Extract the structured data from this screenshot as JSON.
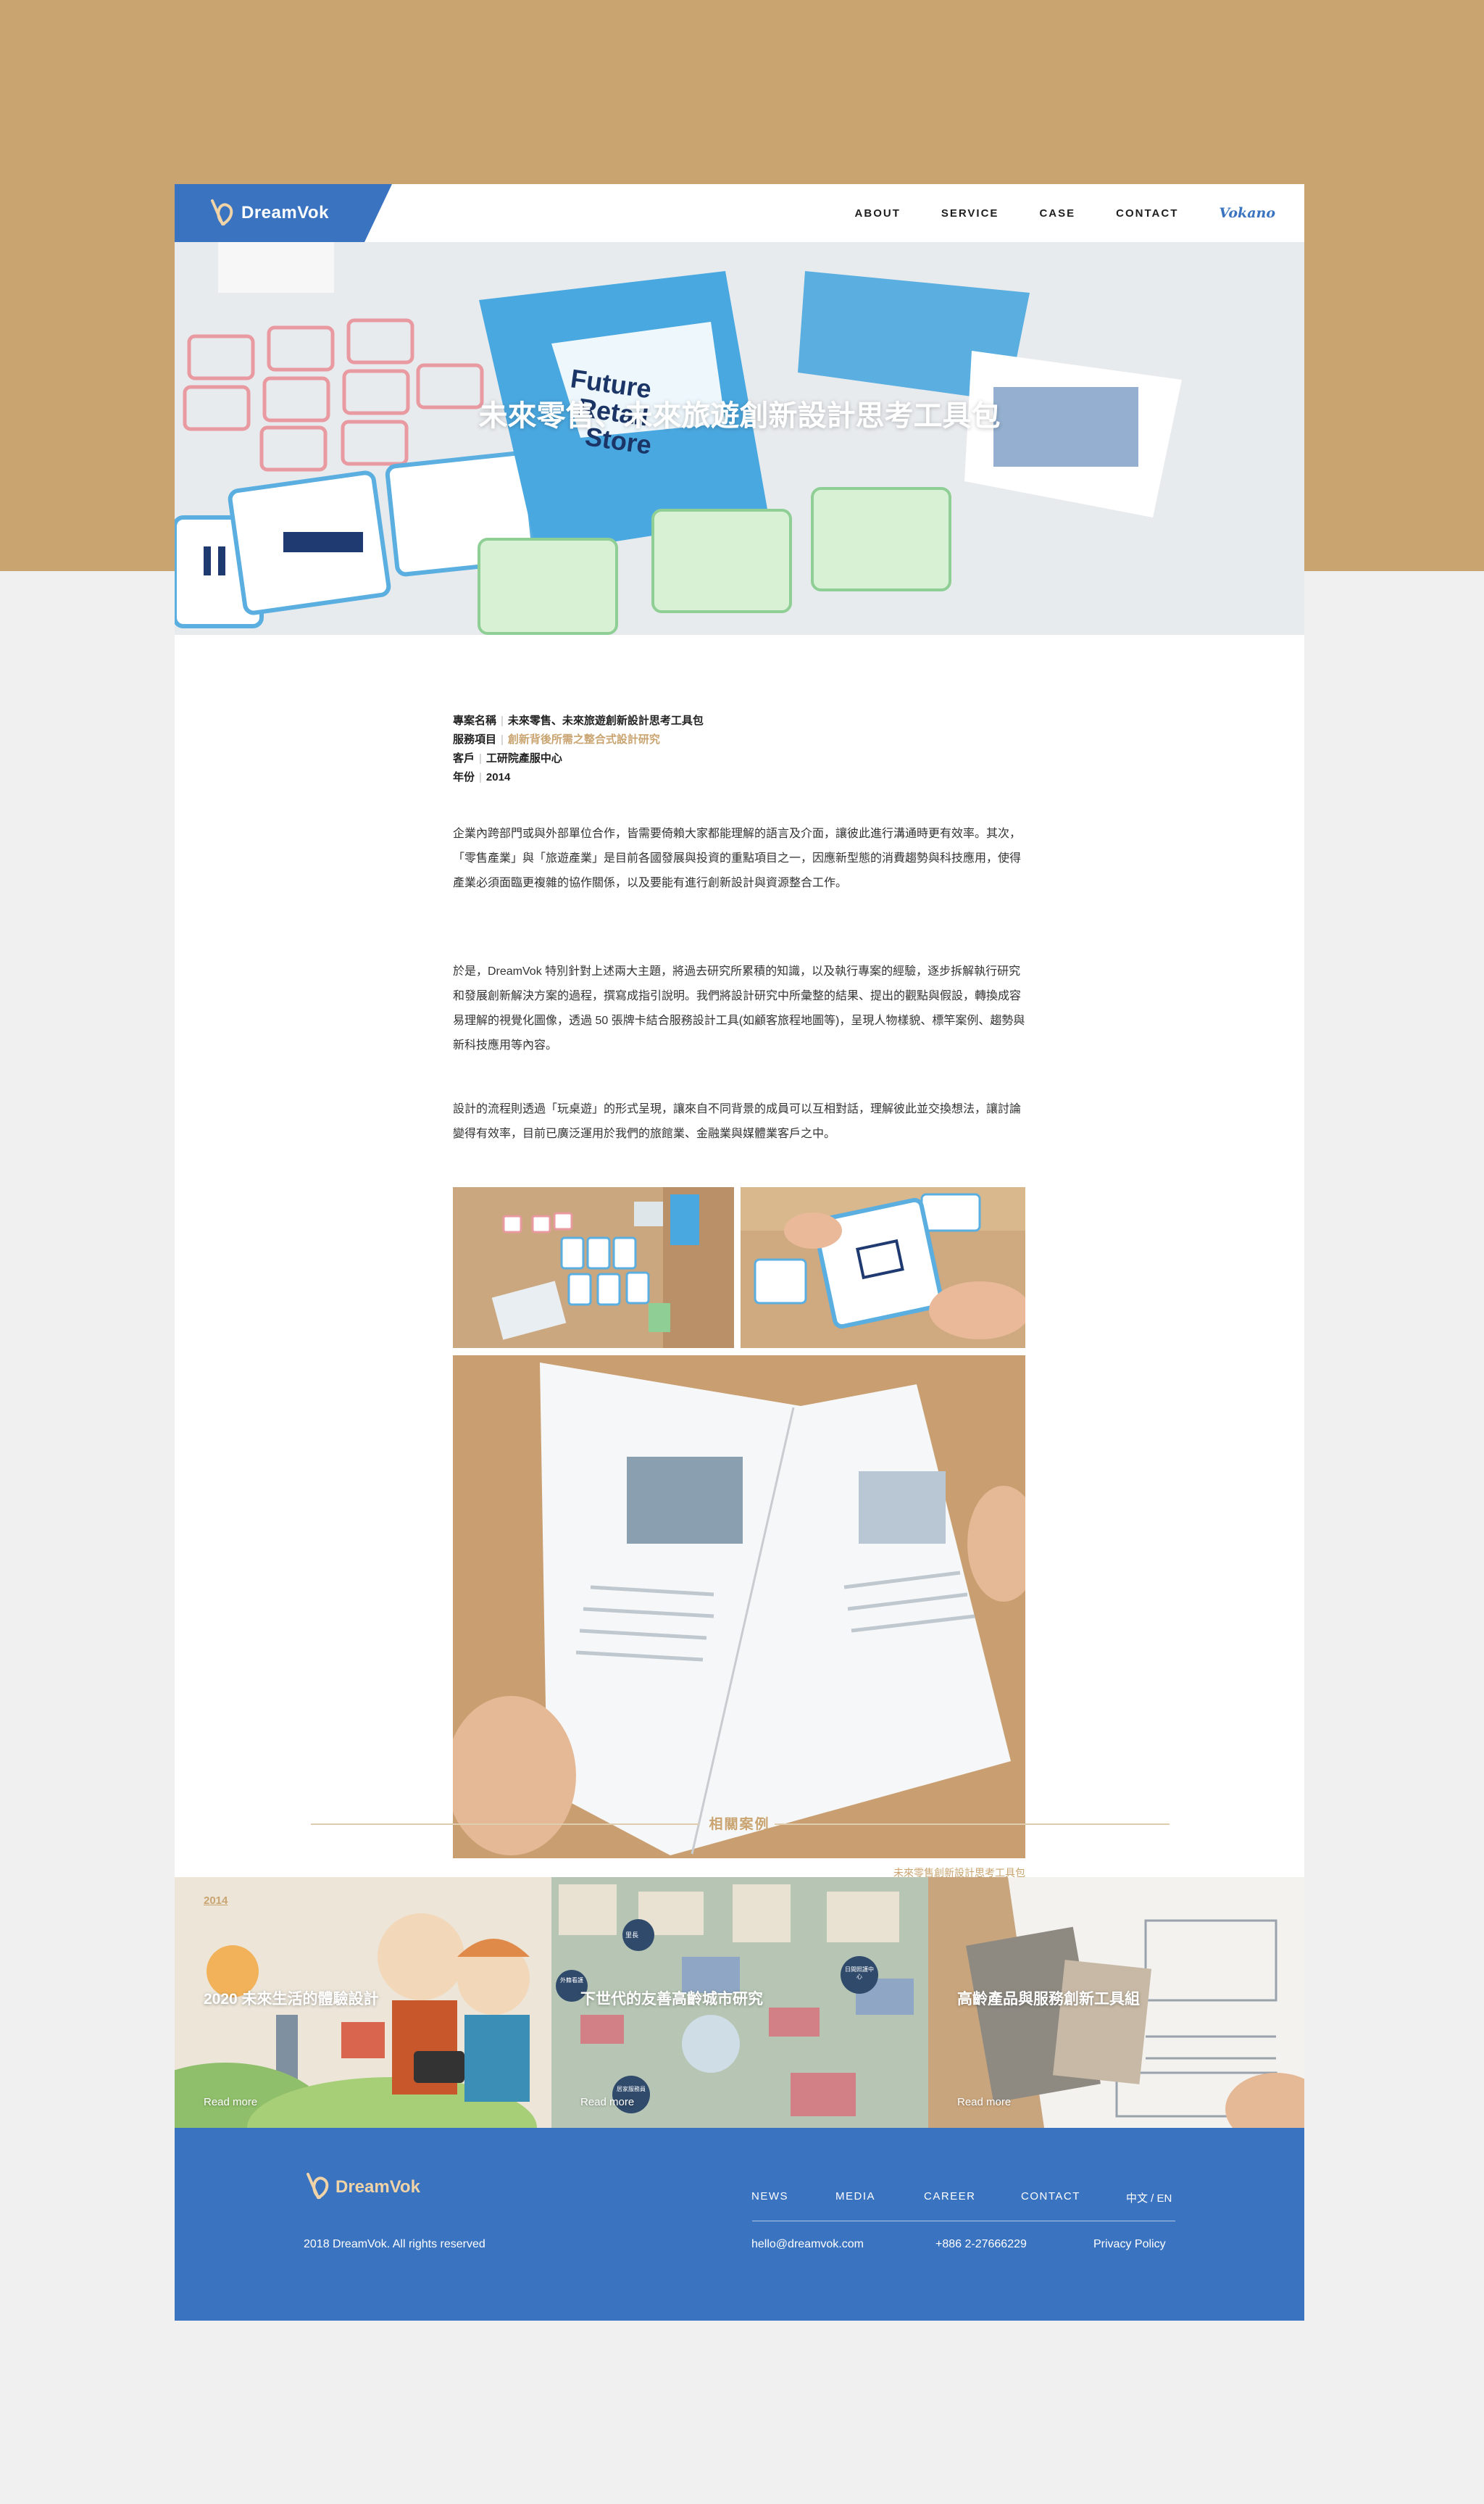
{
  "header": {
    "logo_text": "DreamVok",
    "nav": [
      "ABOUT",
      "SERVICE",
      "CASE",
      "CONTACT"
    ],
    "vokano": "Vokano"
  },
  "hero": {
    "title": "未來零售、未來旅遊創新設計思考工具包"
  },
  "meta": {
    "project_label": "專案名稱",
    "project_value": "未來零售、未來旅遊創新設計思考工具包",
    "service_label": "服務項目",
    "service_value": "創新背後所需之整合式設計研究",
    "client_label": "客戶",
    "client_value": "工研院產服中心",
    "year_label": "年份",
    "year_value": "2014",
    "separator": "|"
  },
  "body": {
    "p1": "企業內跨部門或與外部單位合作，皆需要倚賴大家都能理解的語言及介面，讓彼此進行溝通時更有效率。其次，「零售產業」與「旅遊產業」是目前各國發展與投資的重點項目之一，因應新型態的消費趨勢與科技應用，使得產業必須面臨更複雜的協作關係，以及要能有進行創新設計與資源整合工作。",
    "p2": "於是，DreamVok 特別針對上述兩大主題，將過去研究所累積的知識，以及執行專案的經驗，逐步拆解執行研究和發展創新解決方案的過程，撰寫成指引說明。我們將設計研究中所彙整的結果、提出的觀點與假設，轉換成容易理解的視覺化圖像，透過 50 張牌卡結合服務設計工具(如顧客旅程地圖等)，呈現人物樣貌、標竿案例、趨勢與新科技應用等內容。",
    "p3": "設計的流程則透過「玩桌遊」的形式呈現，讓來自不同背景的成員可以互相對話，理解彼此並交換想法，讓討論變得有效率，目前已廣泛運用於我們的旅館業、金融業與媒體業客戶之中。",
    "caption": "未來零售創新設計思考工具包"
  },
  "related": {
    "title": "相關案例",
    "cards": [
      {
        "year": "2014",
        "title": "2020 未來生活的體驗設計",
        "more": "Read more"
      },
      {
        "year": "",
        "title": "下世代的友善高齡城市研究",
        "more": "Read more"
      },
      {
        "year": "",
        "title": "高齡產品與服務創新工具組",
        "more": "Read more"
      }
    ]
  },
  "map_labels": [
    "里長",
    "外籍看護",
    "日間照護中心",
    "居家服務員"
  ],
  "footer": {
    "logo_text": "DreamVok",
    "nav": [
      "NEWS",
      "MEDIA",
      "CAREER",
      "CONTACT",
      "中文 / EN"
    ],
    "copyright": "2018 DreamVok. All rights reserved",
    "email": "hello@dreamvok.com",
    "phone": "+886 2-27666229",
    "privacy": "Privacy Policy"
  },
  "colors": {
    "brand_blue": "#3a73c0",
    "accent_tan": "#c9a470",
    "background": "#f0f0f0"
  }
}
